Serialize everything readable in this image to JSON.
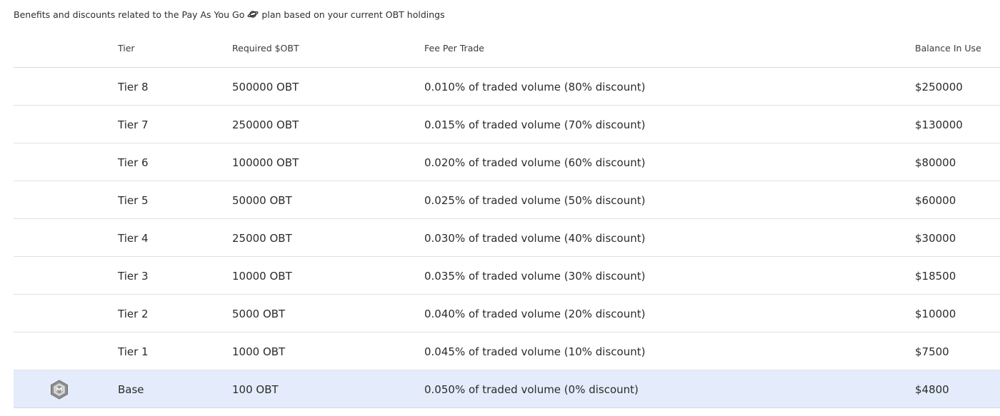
{
  "intro": {
    "before": "Benefits and discounts related to the Pay As You Go",
    "plan_icon": "planet-icon",
    "after": "plan based on your current OBT holdings"
  },
  "table": {
    "headers": {
      "tier": "Tier",
      "required": "Required $OBT",
      "fee": "Fee Per Trade",
      "balance": "Balance In Use"
    },
    "rows": [
      {
        "tier": "Tier 8",
        "required": "500000 OBT",
        "fee": "0.010% of traded volume (80% discount)",
        "balance": "$250000"
      },
      {
        "tier": "Tier 7",
        "required": "250000 OBT",
        "fee": "0.015% of traded volume (70% discount)",
        "balance": "$130000"
      },
      {
        "tier": "Tier 6",
        "required": "100000 OBT",
        "fee": "0.020% of traded volume (60% discount)",
        "balance": "$80000"
      },
      {
        "tier": "Tier 5",
        "required": "50000 OBT",
        "fee": "0.025% of traded volume (50% discount)",
        "balance": "$60000"
      },
      {
        "tier": "Tier 4",
        "required": "25000 OBT",
        "fee": "0.030% of traded volume (40% discount)",
        "balance": "$30000"
      },
      {
        "tier": "Tier 3",
        "required": "10000 OBT",
        "fee": "0.035% of traded volume (30% discount)",
        "balance": "$18500"
      },
      {
        "tier": "Tier 2",
        "required": "5000 OBT",
        "fee": "0.040% of traded volume (20% discount)",
        "balance": "$10000"
      },
      {
        "tier": "Tier 1",
        "required": "1000 OBT",
        "fee": "0.045% of traded volume (10% discount)",
        "balance": "$7500"
      },
      {
        "tier": "Base",
        "required": "100 OBT",
        "fee": "0.050% of traded volume (0% discount)",
        "balance": "$4800",
        "current": true,
        "badge_icon": "tier-badge-icon"
      }
    ]
  },
  "colors": {
    "current_row_bg": "#e4ecfb",
    "divider": "#e2e2e2",
    "text": "#2b2b2b"
  }
}
